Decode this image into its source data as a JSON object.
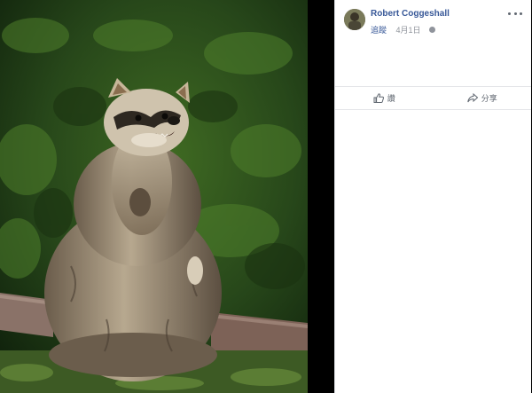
{
  "post": {
    "author": "Robert Coggeshall",
    "follow_label": "追蹤",
    "date": "4月1日",
    "privacy_icon": "globe-icon"
  },
  "photo": {
    "subject": "raccoon-standing-photo"
  },
  "actions": {
    "like_label": "讚",
    "share_label": "分享"
  },
  "icons": {
    "more": "more-options-icon",
    "like": "thumbs-up-icon",
    "share": "share-arrow-icon"
  },
  "colors": {
    "link": "#385898",
    "meta": "#90949c",
    "action": "#606770",
    "panel": "#ffffff",
    "background": "#000000"
  }
}
